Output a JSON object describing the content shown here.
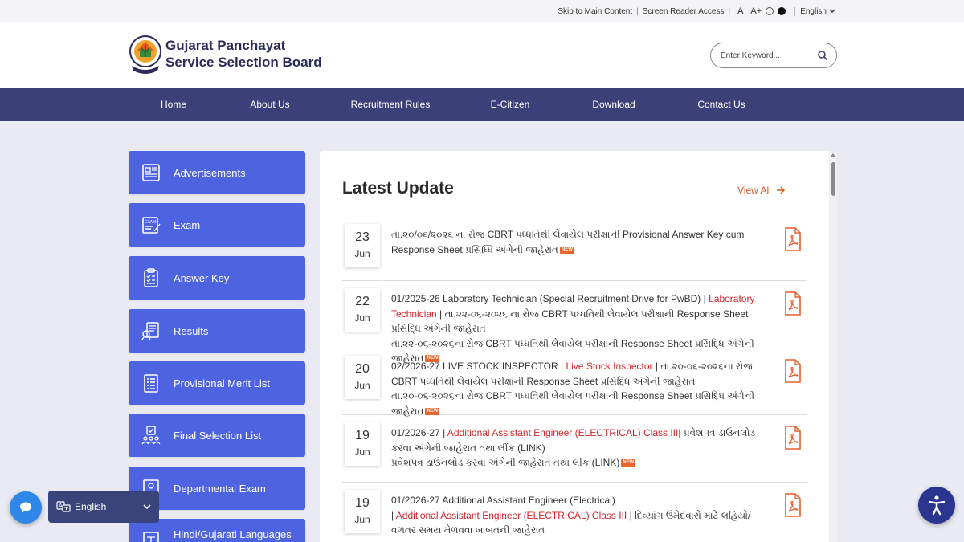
{
  "topbar": {
    "skip_link": "Skip to Main Content",
    "screen_reader": "Screen Reader Access",
    "font_normal": "A",
    "font_large": "A+",
    "language": "English"
  },
  "header": {
    "brand_line1": "Gujarat Panchayat",
    "brand_line2": "Service Selection Board",
    "search_placeholder": "Enter Keyword..."
  },
  "nav": {
    "items": [
      "Home",
      "About Us",
      "Recruitment Rules",
      "E-Citizen",
      "Download",
      "Contact Us"
    ]
  },
  "sidebar": {
    "items": [
      {
        "label": "Advertisements",
        "icon": "newspaper-icon"
      },
      {
        "label": "Exam",
        "icon": "exam-icon"
      },
      {
        "label": "Answer Key",
        "icon": "clipboard-icon"
      },
      {
        "label": "Results",
        "icon": "results-icon"
      },
      {
        "label": "Provisional Merit List",
        "icon": "list-icon"
      },
      {
        "label": "Final Selection List",
        "icon": "people-check-icon"
      },
      {
        "label": "Departmental Exam",
        "icon": "department-icon"
      },
      {
        "label": "Hindi/Gujarati Languages Exam",
        "icon": "language-icon"
      }
    ]
  },
  "latest": {
    "title": "Latest Update",
    "view_all": "View All",
    "new_badge": "NEW",
    "items": [
      {
        "day": "23",
        "month": "Jun",
        "line1": "તા.૨૦/૦૬/૨૦૨૬ ના રોજ CBRT પધ્ધતિથી લેવાયેલ પરીક્ષાની Provisional Answer Key cum Response",
        "line2": "Sheet પ્રસિધ્ધિ અંગેની જાહેરાત"
      },
      {
        "day": "22",
        "month": "Jun",
        "line1_a": "01/2025-26 Laboratory Technician (Special Recruitment Drive for PwBD)",
        "line1_b": "Laboratory Technician",
        "line2": "તા.૨૨-૦૬-૨૦૨૬ ના રોજ CBRT પધ્ધતિથી લેવાયેલ પરીક્ષાની Response Sheet પ્રસિદ્ધિ અંગેની જાહેરાત",
        "line3": "તા.૨૨-૦૬-૨૦૨૬ના રોજ CBRT પધ્ધતિથી લેવાયેલ પરીક્ષાની Response Sheet પ્રસિદ્ધિ અંગેની જાહેરાત"
      },
      {
        "day": "20",
        "month": "Jun",
        "line1_a": "02/2026-27 LIVE STOCK INSPECTOR",
        "line1_b": "Live Stock Inspector",
        "line1_c": "તા.૨૦-૦૬-૨૦૨૬ના રોજ CBRT પધ્ધતિથી",
        "line2": "લેવાયેલ પરીક્ષાની Response Sheet પ્રસિદ્ધિ અંગેની જાહેરાત",
        "line3": "તા.૨૦-૦૬-૨૦૨૬ના રોજ CBRT પધ્ધતિથી લેવાયેલ પરીક્ષાની Response Sheet પ્રસિદ્ધિ અંગેની જાહેરાત"
      },
      {
        "day": "19",
        "month": "Jun",
        "line1_a": "01/2026-27",
        "line1_b": "Additional Assistant Engineer (ELECTRICAL) Class III",
        "line1_c": "પ્રવેશપત્ર ડાઉનલોડ કરવા",
        "line2": "અંગેની જાહેરાત તથા લીંક (LINK)",
        "line3": "પ્રવેશપત્ર ડાઉનલોડ કરવા અંગેની જાહેરાત તથા લીંક (LINK)"
      },
      {
        "day": "19",
        "month": "Jun",
        "line1": "01/2026-27 Additional Assistant Engineer (Electrical)",
        "line2_b": "Additional Assistant Engineer (ELECTRICAL) Class III",
        "line2_c": "દિવ્યાંગ ઉમેદવારો માટે લહિયો/વળતર સમય",
        "line3": "મેળવવા બાબતની જાહેરાત"
      }
    ]
  },
  "widgets": {
    "language": "English"
  },
  "colors": {
    "nav_bg": "#3c4079",
    "sidebar_btn": "#4e63e0",
    "accent_orange": "#d9581e",
    "link_red": "#d0262b"
  }
}
